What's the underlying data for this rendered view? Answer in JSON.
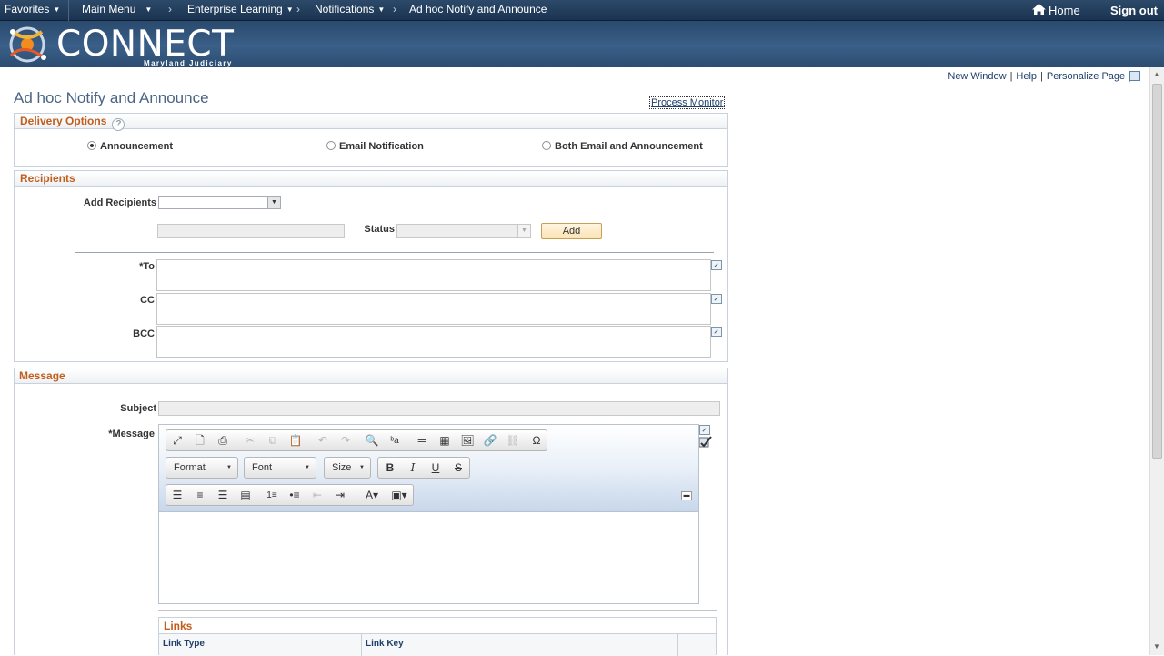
{
  "nav": {
    "favorites": "Favorites",
    "main_menu": "Main Menu",
    "enterprise_learning": "Enterprise Learning",
    "notifications": "Notifications",
    "current": "Ad hoc Notify and Announce",
    "home": "Home",
    "sign_out": "Sign out"
  },
  "banner": {
    "logo_text": "CONNECT",
    "logo_sub": "Maryland Judiciary"
  },
  "page_links": {
    "new_window": "New Window",
    "help": "Help",
    "personalize": "Personalize Page"
  },
  "page": {
    "title": "Ad hoc Notify and Announce",
    "process_monitor": "Process Monitor"
  },
  "delivery": {
    "header": "Delivery Options",
    "help_glyph": "?",
    "options": [
      {
        "label": "Announcement",
        "checked": true
      },
      {
        "label": "Email Notification",
        "checked": false
      },
      {
        "label": "Both Email and Announcement",
        "checked": false
      }
    ]
  },
  "recipients": {
    "header": "Recipients",
    "add_label": "Add Recipients",
    "add_value": "",
    "status_label": "Status",
    "add_button": "Add",
    "to_label": "*To",
    "cc_label": "CC",
    "bcc_label": "BCC"
  },
  "message": {
    "header": "Message",
    "subject_label": "Subject",
    "message_label": "*Message",
    "format_combo": "Format",
    "font_combo": "Font",
    "size_combo": "Size"
  },
  "links": {
    "header": "Links",
    "col_link_type": "Link Type",
    "col_link_key": "Link Key"
  }
}
